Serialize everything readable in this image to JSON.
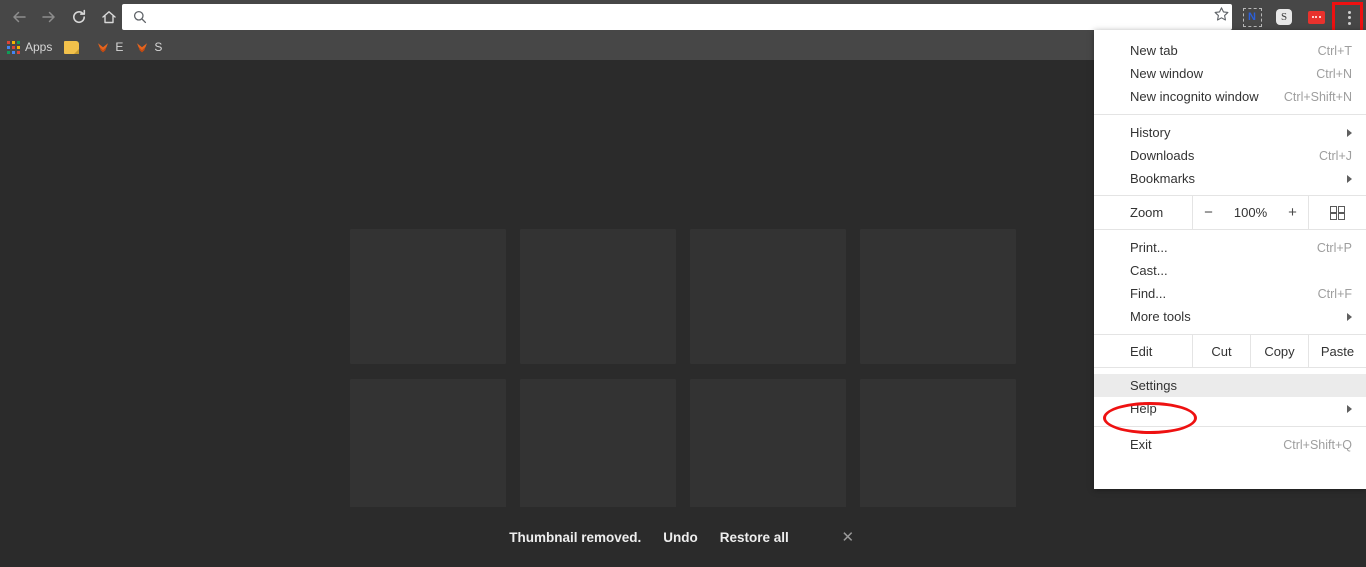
{
  "toolbar": {
    "back_icon": "back-arrow-icon",
    "forward_icon": "forward-arrow-icon",
    "reload_icon": "reload-icon",
    "home_icon": "home-icon",
    "omnibox_value": "",
    "omnibox_placeholder": "",
    "omnibox_search_icon": "search-icon",
    "star_icon": "bookmark-star-icon",
    "extensions": [
      {
        "name": "onenote-clipper-extension",
        "glyph": "N"
      },
      {
        "name": "s-extension",
        "glyph": "S"
      },
      {
        "name": "red-extension",
        "glyph": ""
      }
    ],
    "menu_button_icon": "three-dot-menu-icon"
  },
  "bookmarks_bar": {
    "items": [
      {
        "label": "Apps",
        "icon": "apps-grid-icon"
      },
      {
        "label": "",
        "icon": "folder-icon"
      },
      {
        "label": "E",
        "icon": "chevron-favicon"
      },
      {
        "label": "S",
        "icon": "chevron-favicon"
      }
    ]
  },
  "newtab": {
    "tiles": [
      {
        "label": ""
      },
      {
        "label": ""
      },
      {
        "label": ""
      },
      {
        "label": ""
      },
      {
        "label": ""
      },
      {
        "label": ""
      },
      {
        "label": ""
      },
      {
        "label": ""
      }
    ]
  },
  "notification": {
    "message": "Thumbnail removed.",
    "undo_label": "Undo",
    "restore_all_label": "Restore all",
    "close_icon": "close-icon"
  },
  "menu": {
    "groups": [
      {
        "items": [
          {
            "label": "New tab",
            "shortcut": "Ctrl+T",
            "submenu": false
          },
          {
            "label": "New window",
            "shortcut": "Ctrl+N",
            "submenu": false
          },
          {
            "label": "New incognito window",
            "shortcut": "Ctrl+Shift+N",
            "submenu": false
          }
        ]
      },
      {
        "items": [
          {
            "label": "History",
            "shortcut": "",
            "submenu": true
          },
          {
            "label": "Downloads",
            "shortcut": "Ctrl+J",
            "submenu": false
          },
          {
            "label": "Bookmarks",
            "shortcut": "",
            "submenu": true
          }
        ]
      }
    ],
    "zoom_row": {
      "label": "Zoom",
      "minus_label": "−",
      "value": "100%",
      "plus_label": "+",
      "fullscreen_icon": "fullscreen-icon"
    },
    "tools_group": [
      {
        "label": "Print...",
        "shortcut": "Ctrl+P",
        "submenu": false
      },
      {
        "label": "Cast...",
        "shortcut": "",
        "submenu": false
      },
      {
        "label": "Find...",
        "shortcut": "Ctrl+F",
        "submenu": false
      },
      {
        "label": "More tools",
        "shortcut": "",
        "submenu": true
      }
    ],
    "edit_row": {
      "label": "Edit",
      "cut_label": "Cut",
      "copy_label": "Copy",
      "paste_label": "Paste"
    },
    "settings_group": [
      {
        "label": "Settings",
        "shortcut": "",
        "submenu": false,
        "highlighted": true
      },
      {
        "label": "Help",
        "shortcut": "",
        "submenu": true,
        "highlighted": false
      }
    ],
    "exit_group": [
      {
        "label": "Exit",
        "shortcut": "Ctrl+Shift+Q",
        "submenu": false
      }
    ]
  },
  "annotations": {
    "settings_highlight_color": "#ee1111",
    "menu_button_highlight_color": "#ee1111"
  },
  "colors": {
    "chrome_toolbar": "#474747",
    "page_background": "#2b2b2b",
    "tile": "#333333",
    "menu_background": "#ffffff"
  }
}
